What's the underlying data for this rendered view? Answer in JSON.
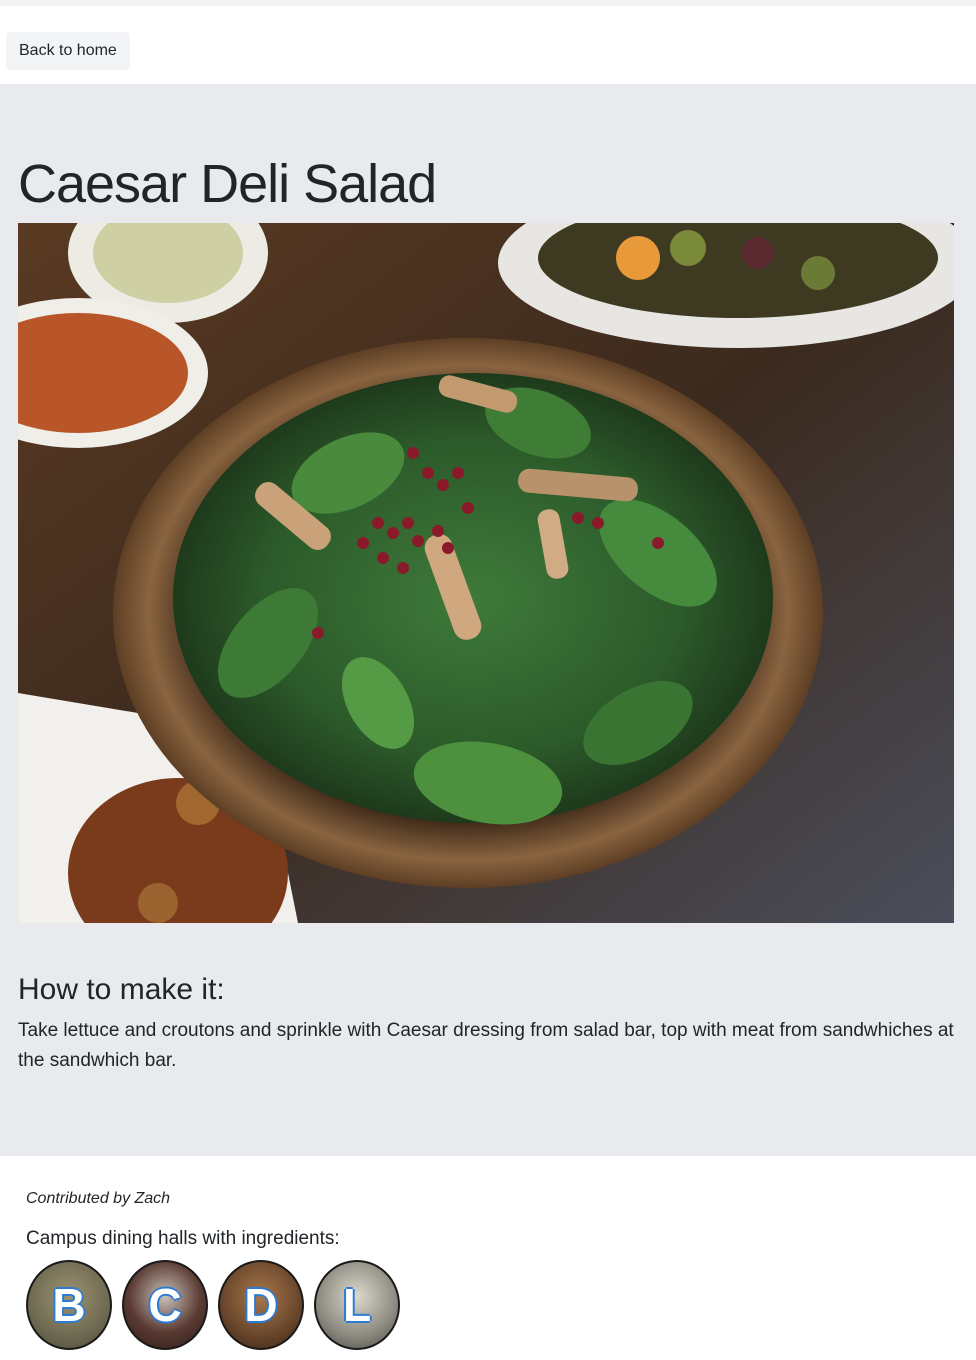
{
  "nav": {
    "back_label": "Back to home"
  },
  "recipe": {
    "title": "Caesar Deli Salad",
    "image_alt": "Salad with spinach, chicken and pomegranate in a wooden bowl",
    "how_heading": "How to make it:",
    "instructions": "Take lettuce and croutons and sprinkle with Caesar dressing from salad bar, top with meat from sandwhiches at the sandwhich bar."
  },
  "footer": {
    "contributed": "Contributed by Zach",
    "halls_label": "Campus dining halls with ingredients:",
    "halls": [
      {
        "letter": "B",
        "bg": "#6f6a52"
      },
      {
        "letter": "C",
        "bg": "#5a3a32"
      },
      {
        "letter": "D",
        "bg": "#6e4a2e"
      },
      {
        "letter": "L",
        "bg": "#8c8a80"
      }
    ]
  }
}
